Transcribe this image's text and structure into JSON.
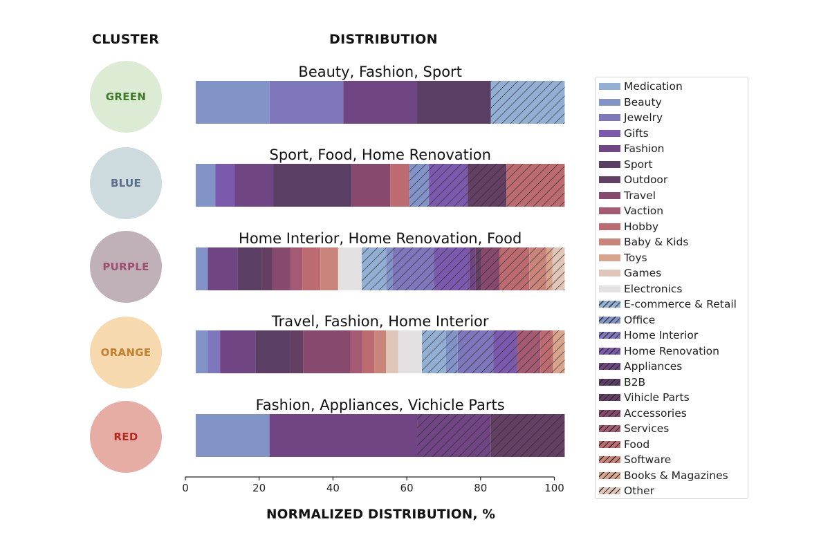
{
  "headers": {
    "cluster": "CLUSTER",
    "distribution": "DISTRIBUTION"
  },
  "chart_data": {
    "type": "bar",
    "orientation": "horizontal-stacked",
    "xlabel": "NORMALIZED DISTRIBUTION, %",
    "xlim": [
      0,
      100
    ],
    "bar_offset": 2.8,
    "xticks": [
      0,
      20,
      40,
      60,
      80,
      100
    ],
    "grid": false,
    "legend_position": "right",
    "categories_legend": [
      {
        "name": "Medication",
        "color": "#93b0d4",
        "hatch": false
      },
      {
        "name": "Beauty",
        "color": "#8293c8",
        "hatch": false
      },
      {
        "name": "Jewelry",
        "color": "#7f77bb",
        "hatch": false
      },
      {
        "name": "Gifts",
        "color": "#7b5aad",
        "hatch": false
      },
      {
        "name": "Fashion",
        "color": "#6f4583",
        "hatch": false
      },
      {
        "name": "Sport",
        "color": "#5a3e63",
        "hatch": false
      },
      {
        "name": "Outdoor",
        "color": "#633f63",
        "hatch": false
      },
      {
        "name": "Travel",
        "color": "#874a6e",
        "hatch": false
      },
      {
        "name": "Vaction",
        "color": "#a45a72",
        "hatch": false
      },
      {
        "name": "Hobby",
        "color": "#bc6c70",
        "hatch": false
      },
      {
        "name": "Baby & Kids",
        "color": "#c9857a",
        "hatch": false
      },
      {
        "name": "Toys",
        "color": "#d9a48d",
        "hatch": false
      },
      {
        "name": "Games",
        "color": "#e0c6b9",
        "hatch": false
      },
      {
        "name": "Electronics",
        "color": "#e4e1e3",
        "hatch": false
      },
      {
        "name": "E-commerce & Retail",
        "color": "#93b0d4",
        "hatch": true
      },
      {
        "name": "Office",
        "color": "#8293c8",
        "hatch": true
      },
      {
        "name": "Home Interior",
        "color": "#7f77bb",
        "hatch": true
      },
      {
        "name": "Home Renovation",
        "color": "#7b5aad",
        "hatch": true
      },
      {
        "name": "Appliances",
        "color": "#6f4583",
        "hatch": true
      },
      {
        "name": "B2B",
        "color": "#5a3e63",
        "hatch": true
      },
      {
        "name": "Vihicle Parts",
        "color": "#633f63",
        "hatch": true
      },
      {
        "name": "Accessories",
        "color": "#874a6e",
        "hatch": true
      },
      {
        "name": "Services",
        "color": "#a45a72",
        "hatch": true
      },
      {
        "name": "Food",
        "color": "#bc6c70",
        "hatch": true
      },
      {
        "name": "Software",
        "color": "#c9857a",
        "hatch": true
      },
      {
        "name": "Books & Magazines",
        "color": "#d9a48d",
        "hatch": true
      },
      {
        "name": "Other",
        "color": "#e0c6b9",
        "hatch": true
      }
    ],
    "clusters": [
      {
        "name": "GREEN",
        "circle_color": "#dcecd4",
        "text_color": "#3f7a2a",
        "title": "Beauty, Fashion, Sport",
        "segments": [
          {
            "category": "Beauty",
            "value": 20
          },
          {
            "category": "Jewelry",
            "value": 20
          },
          {
            "category": "Fashion",
            "value": 20
          },
          {
            "category": "Sport",
            "value": 20
          },
          {
            "category": "E-commerce & Retail",
            "value": 20
          }
        ]
      },
      {
        "name": "BLUE",
        "circle_color": "#cddbdf",
        "text_color": "#5b6b8a",
        "title": "Sport, Food, Home Renovation",
        "segments": [
          {
            "category": "Beauty",
            "value": 5.3
          },
          {
            "category": "Gifts",
            "value": 5.3
          },
          {
            "category": "Fashion",
            "value": 10.5
          },
          {
            "category": "Sport",
            "value": 21.1
          },
          {
            "category": "Travel",
            "value": 10.5
          },
          {
            "category": "Hobby",
            "value": 5.2
          },
          {
            "category": "Office",
            "value": 5.3
          },
          {
            "category": "Home Renovation",
            "value": 10.5
          },
          {
            "category": "Vihicle Parts",
            "value": 10.5
          },
          {
            "category": "Food",
            "value": 15.8
          }
        ]
      },
      {
        "name": "PURPLE",
        "circle_color": "#c0b0b8",
        "text_color": "#9c4f6e",
        "title": "Home Interior, Home Renovation, Food",
        "segments": [
          {
            "category": "Beauty",
            "value": 3.3
          },
          {
            "category": "Fashion",
            "value": 8.0
          },
          {
            "category": "Sport",
            "value": 6.4
          },
          {
            "category": "Outdoor",
            "value": 3.1
          },
          {
            "category": "Travel",
            "value": 4.9
          },
          {
            "category": "Vaction",
            "value": 3.2
          },
          {
            "category": "Hobby",
            "value": 4.9
          },
          {
            "category": "Baby & Kids",
            "value": 4.8
          },
          {
            "category": "Electronics",
            "value": 6.4
          },
          {
            "category": "E-commerce & Retail",
            "value": 6.6
          },
          {
            "category": "Office",
            "value": 1.7
          },
          {
            "category": "Home Interior",
            "value": 11.3
          },
          {
            "category": "Home Renovation",
            "value": 9.5
          },
          {
            "category": "Appliances",
            "value": 1.7
          },
          {
            "category": "Vihicle Parts",
            "value": 1.6
          },
          {
            "category": "Accessories",
            "value": 4.9
          },
          {
            "category": "Food",
            "value": 8.1
          },
          {
            "category": "Software",
            "value": 4.7
          },
          {
            "category": "Books & Magazines",
            "value": 1.6
          },
          {
            "category": "Other",
            "value": 3.3
          }
        ]
      },
      {
        "name": "ORANGE",
        "circle_color": "#f7d9b0",
        "text_color": "#c37f2d",
        "title": "Travel, Fashion, Home Interior",
        "segments": [
          {
            "category": "Beauty",
            "value": 3.3
          },
          {
            "category": "Jewelry",
            "value": 3.3
          },
          {
            "category": "Fashion",
            "value": 9.6
          },
          {
            "category": "Sport",
            "value": 9.6
          },
          {
            "category": "Outdoor",
            "value": 3.3
          },
          {
            "category": "Travel",
            "value": 12.8
          },
          {
            "category": "Vaction",
            "value": 3.3
          },
          {
            "category": "Hobby",
            "value": 3.3
          },
          {
            "category": "Baby & Kids",
            "value": 3.1
          },
          {
            "category": "Games",
            "value": 3.3
          },
          {
            "category": "Electronics",
            "value": 6.4
          },
          {
            "category": "E-commerce & Retail",
            "value": 6.5
          },
          {
            "category": "Office",
            "value": 3.2
          },
          {
            "category": "Home Interior",
            "value": 9.7
          },
          {
            "category": "Home Renovation",
            "value": 6.4
          },
          {
            "category": "Services",
            "value": 6.4
          },
          {
            "category": "Food",
            "value": 3.3
          },
          {
            "category": "Books & Magazines",
            "value": 3.2
          }
        ]
      },
      {
        "name": "RED",
        "circle_color": "#e6ada5",
        "text_color": "#b42a22",
        "title": "Fashion, Appliances, Vichicle Parts",
        "segments": [
          {
            "category": "Beauty",
            "value": 20
          },
          {
            "category": "Fashion",
            "value": 40
          },
          {
            "category": "Appliances",
            "value": 20
          },
          {
            "category": "Vihicle Parts",
            "value": 20
          }
        ]
      }
    ]
  }
}
